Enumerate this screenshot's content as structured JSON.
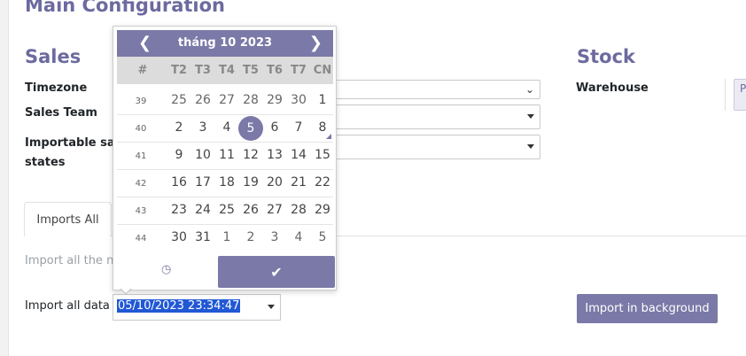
{
  "page": {
    "title": "Main Configuration"
  },
  "sales": {
    "title": "Sales",
    "timezone_label": "Timezone",
    "sales_team_label": "Sales Team",
    "importable_label_line1": "Importable sal",
    "importable_label_line2": "states"
  },
  "stock": {
    "title": "Stock",
    "warehouse_label": "Warehouse",
    "warehouse_box_text": "P"
  },
  "tabs": [
    {
      "label": "Imports All"
    }
  ],
  "import_section": {
    "helper_text": "Import all the ne",
    "data_label": "Import all data",
    "datetime_value": "05/10/2023 23:34:47",
    "button_label": "Import in background"
  },
  "datepicker": {
    "month_title": "tháng 10 2023",
    "dow": [
      "#",
      "T2",
      "T3",
      "T4",
      "T5",
      "T6",
      "T7",
      "CN"
    ],
    "weeks": [
      {
        "week": "39",
        "days": [
          "25",
          "26",
          "27",
          "28",
          "29",
          "30",
          "1"
        ]
      },
      {
        "week": "40",
        "days": [
          "2",
          "3",
          "4",
          "5",
          "6",
          "7",
          "8"
        ]
      },
      {
        "week": "41",
        "days": [
          "9",
          "10",
          "11",
          "12",
          "13",
          "14",
          "15"
        ]
      },
      {
        "week": "42",
        "days": [
          "16",
          "17",
          "18",
          "19",
          "20",
          "21",
          "22"
        ]
      },
      {
        "week": "43",
        "days": [
          "23",
          "24",
          "25",
          "26",
          "27",
          "28",
          "29"
        ]
      },
      {
        "week": "44",
        "days": [
          "30",
          "31",
          "1",
          "2",
          "3",
          "4",
          "5"
        ]
      }
    ],
    "selected_day": "5",
    "accent": "#7b79a7",
    "prev_icon": "chevron-left-icon",
    "next_icon": "chevron-right-icon",
    "clock_icon": "clock-icon",
    "check_icon": "check-icon"
  }
}
